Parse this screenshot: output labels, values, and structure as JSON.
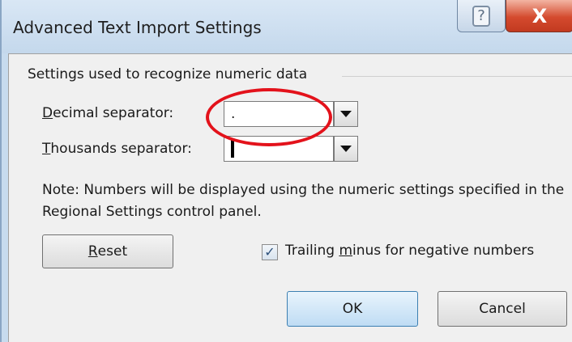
{
  "window": {
    "title": "Advanced Text Import Settings",
    "help_glyph": "?",
    "close_glyph": "X"
  },
  "group": {
    "label": "Settings used to recognize numeric data"
  },
  "decimal": {
    "label_prefix": "D",
    "label_rest": "ecimal separator:",
    "value": "."
  },
  "thousands": {
    "label_prefix": "T",
    "label_rest": "housands separator:",
    "value": ""
  },
  "note": "Note: Numbers will be displayed using the numeric settings specified in the Regional Settings control panel.",
  "reset": {
    "prefix": "R",
    "rest": "eset"
  },
  "trailing_minus": {
    "checked": true,
    "label_before": "Trailing ",
    "label_ul": "m",
    "label_after": "inus for negative numbers"
  },
  "ok_label": "OK",
  "cancel_label": "Cancel",
  "icons": {
    "help": "question-mark-icon",
    "close": "close-x-icon",
    "dropdown": "chevron-down-icon",
    "check": "checkmark-icon"
  },
  "colors": {
    "highlight_ring": "#e3121b",
    "close_button": "#d44a2e",
    "ok_border": "#3c7fb1"
  }
}
